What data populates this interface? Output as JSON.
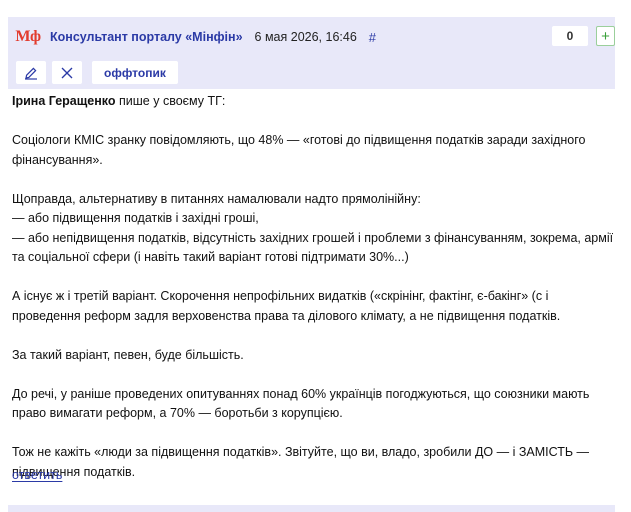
{
  "header": {
    "logo": "Мф",
    "author": "Консультант порталу «Мінфін»",
    "date": "6 мая 2026, 16:46",
    "permalink": "#",
    "vote_count": "0",
    "vote_plus": "+",
    "tag": "оффтопик",
    "icons": [
      "pencil-icon",
      "close-icon"
    ],
    "colors": {
      "header_bg": "#e8e8f9",
      "accent": "#2b3aa6",
      "logo": "#e23b2e",
      "vote_plus": "#3aa03a"
    }
  },
  "body": {
    "intro_name": "Ірина Геращенко",
    "intro_rest": " пише у своєму ТГ:",
    "p1": "Соціологи КМІС зранку повідомляють, що 48% — «готові до підвищення податків заради західного фінансування».",
    "p2_l1": "Щоправда, альтернативу в питаннях намалювали надто прямолінійну:",
    "p2_l2": "— або підвищення податків і західні гроші,",
    "p2_l3": "— або непідвищення податків, відсутність західних грошей і проблеми з фінансуванням, зокрема, армії та соціальної сфери (і навіть такий варіант готові підтримати 30%...)",
    "p3": "А існує ж і третій варіант. Скорочення непрофільних видатків («скрінінг, фактінг, є-бакінг» (с і проведення реформ задля верховенства права та ділового клімату, а не підвищення податків.",
    "p4": "За такий варіант, певен, буде більшість.",
    "p5": "До речі, у раніше проведених опитуваннях понад 60% українців погоджуються, що союзники мають право вимагати реформ, а 70% — боротьби з корупцією.",
    "p6": "Тож не кажіть «люди за підвищення податків». Звітуйте, що ви, владо, зробили ДО — і ЗАМІСТЬ — підвищення податків."
  },
  "reply": "ответить"
}
